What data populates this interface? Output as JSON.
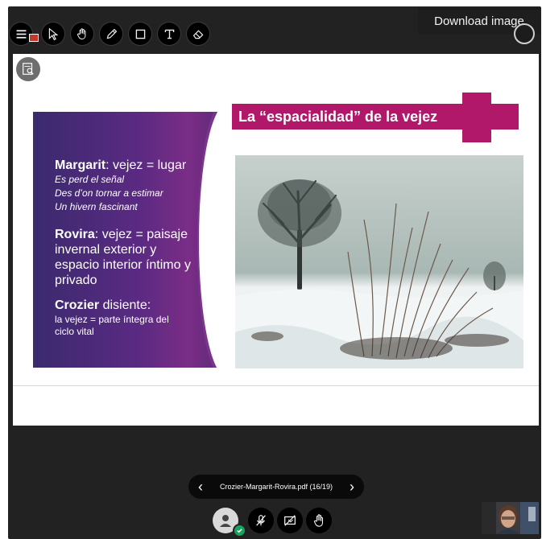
{
  "tooltip": "Download image",
  "toolbar": {
    "tools": [
      {
        "name": "pointer-tool",
        "icon": "cursor-arrow-icon"
      },
      {
        "name": "pan-tool",
        "icon": "hand-icon"
      },
      {
        "name": "pencil-tool",
        "icon": "pencil-icon"
      },
      {
        "name": "shape-tool",
        "icon": "square-icon"
      },
      {
        "name": "text-tool",
        "icon": "text-icon"
      },
      {
        "name": "eraser-tool",
        "icon": "eraser-icon"
      }
    ]
  },
  "slide": {
    "title": "La “espacialidad” de la vejez",
    "left": {
      "margarit_name": "Margarit",
      "margarit_rest": ": vejez = lugar",
      "margarit_lines": [
        "Es perd el señal",
        "Des d’on tornar a estimar",
        "Un hivern fascinant"
      ],
      "rovira_name": "Rovira",
      "rovira_rest": ": vejez = paisaje",
      "rovira_lines": [
        "invernal exterior y",
        "espacio interior íntimo y",
        "privado"
      ],
      "crozier_name": "Crozier",
      "crozier_rest": " disiente:",
      "crozier_lines": [
        "la vejez = parte íntegra del",
        "ciclo vital"
      ]
    }
  },
  "pager": {
    "filename": "Crozier-Margarit-Rovira.pdf",
    "page": "(16/19)",
    "prev": "‹",
    "next": "›"
  },
  "colors": {
    "accent": "#b2186a",
    "status": "#19a15f"
  }
}
